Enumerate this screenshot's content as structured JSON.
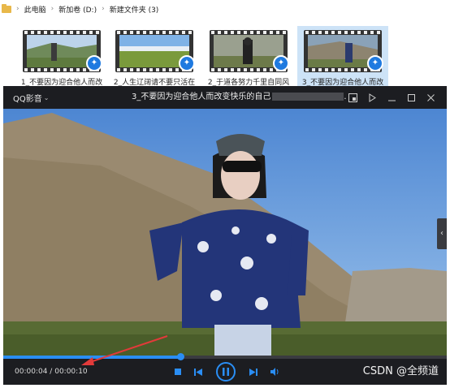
{
  "breadcrumb": {
    "items": [
      "此电脑",
      "新加卷 (D:)",
      "新建文件夹 (3)"
    ],
    "separator": "›"
  },
  "files": [
    {
      "label": "1_不要因为迎合他人而改",
      "selected": false
    },
    {
      "label": "2_人生辽阔请不要只活在",
      "selected": false
    },
    {
      "label": "2_于道各努力千里自同风",
      "selected": false
    },
    {
      "label": "3_不要因为迎合他人而改",
      "selected": true
    }
  ],
  "player": {
    "app_name": "QQ影音",
    "title": "3_不要因为迎合他人而改变快乐的自己",
    "title_suffix": ".",
    "current_time": "00:00:04",
    "total_time": "00:00:10",
    "time_separator": "/",
    "progress": 0.4,
    "watermark": "CSDN @全频道",
    "accent_color": "#2a8ef5"
  },
  "icons": {
    "folder": "folder-icon",
    "film": "film-icon",
    "badge": "qq-player-badge-icon",
    "menu_caret": "chevron-down-icon",
    "pip": "picture-in-picture-icon",
    "pin": "pin-icon",
    "minimize": "minimize-icon",
    "maximize": "maximize-icon",
    "close": "close-icon",
    "stop": "stop-icon",
    "prev": "previous-icon",
    "pause": "pause-icon",
    "next": "next-icon",
    "volume": "volume-icon",
    "side": "chevron-left-icon"
  }
}
